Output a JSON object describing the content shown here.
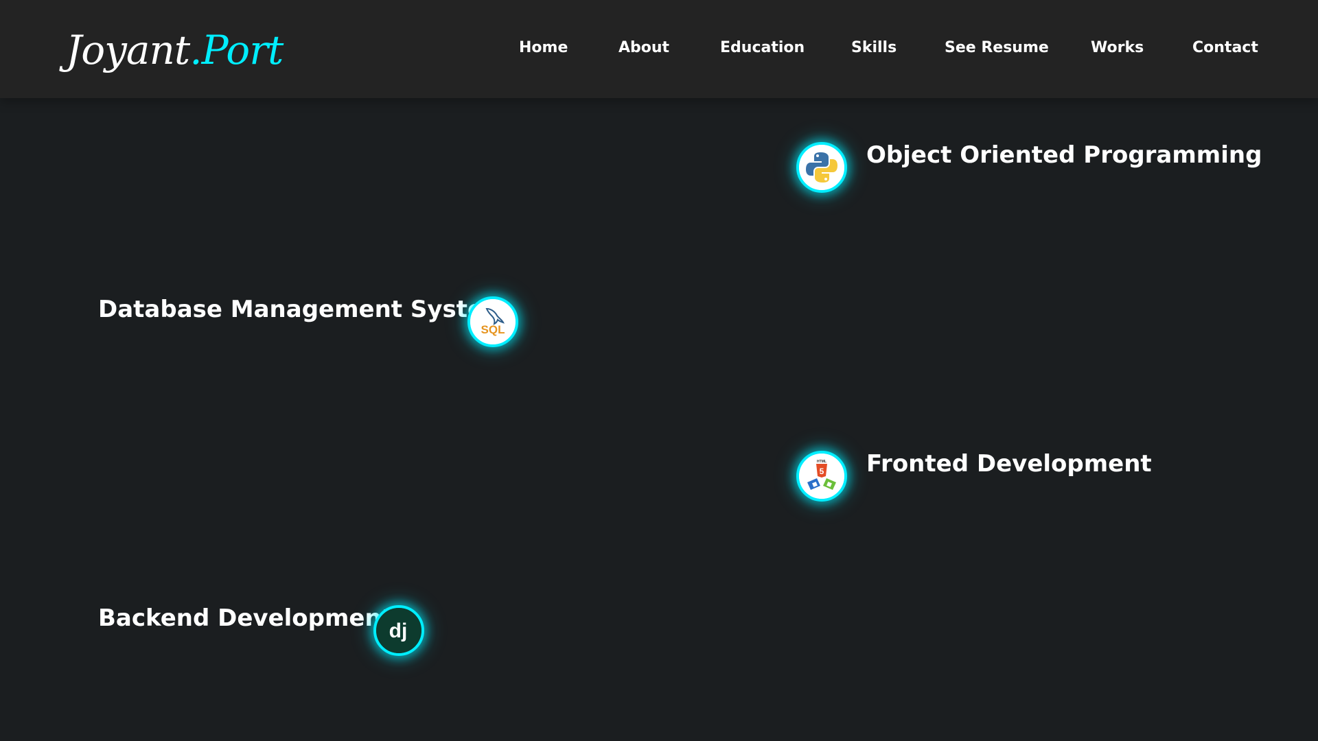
{
  "header": {
    "logo": {
      "main": "Joyant",
      "accent": ".Port"
    },
    "nav": [
      "Home",
      "About",
      "Education",
      "Skills",
      "See Resume",
      "Works",
      "Contact"
    ]
  },
  "skills": [
    {
      "title": "Object Oriented Programming",
      "icon": "python-icon"
    },
    {
      "title": "Database Management System",
      "icon": "mysql-icon"
    },
    {
      "title": "Fronted Development",
      "icon": "html-css-js-icon"
    },
    {
      "title": "Backend Development",
      "icon": "django-icon"
    }
  ],
  "icon_text": {
    "sql": "SQL",
    "html": "HTML",
    "html_num": "5",
    "django": "dj"
  },
  "colors": {
    "accent": "#00eeff",
    "background": "#1b1e20",
    "header": "#232323",
    "text": "#ffffff"
  }
}
